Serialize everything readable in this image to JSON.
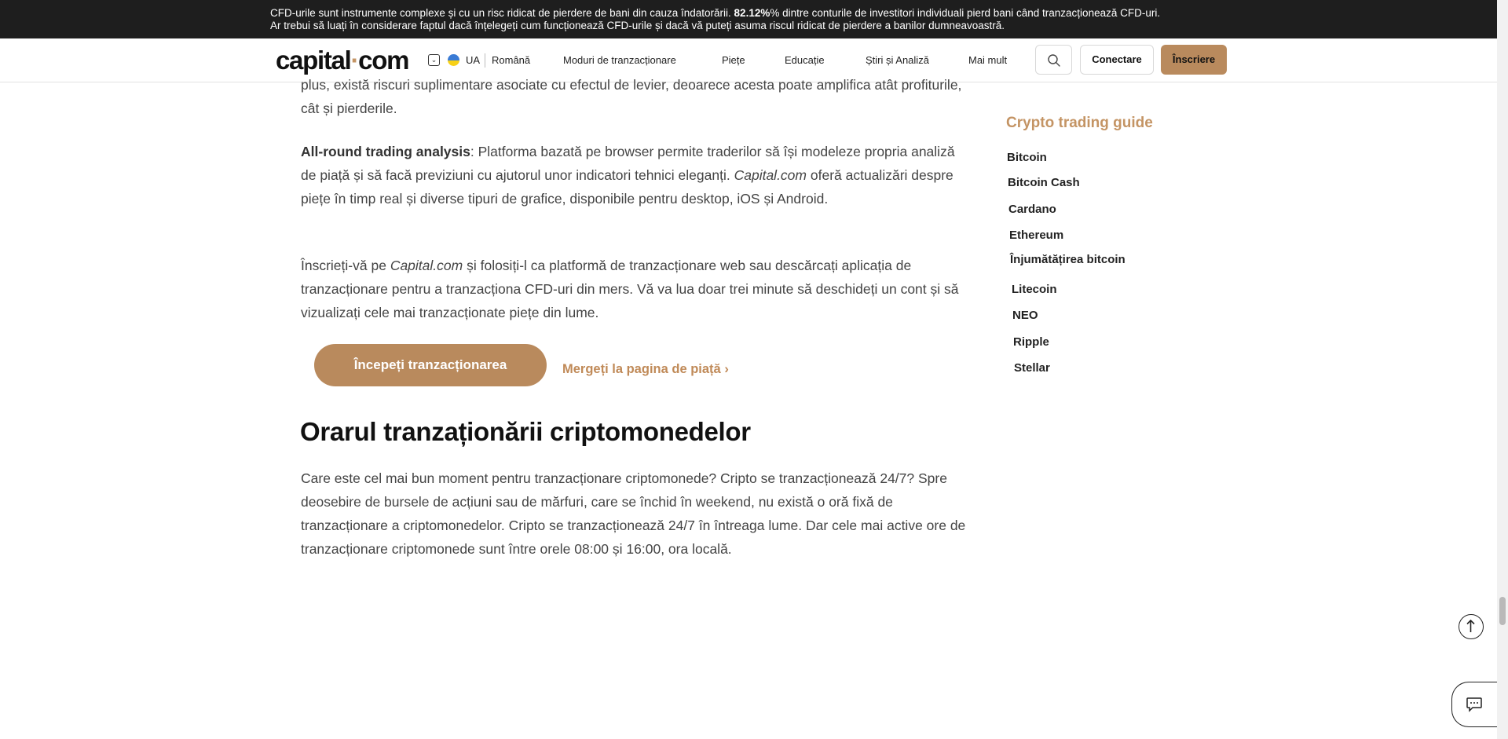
{
  "risk_warning": {
    "line1_prefix": "CFD-urile sunt instrumente complexe și cu un risc ridicat de pierdere de bani din cauza îndatorării.",
    "percentage": "82.12%",
    "line1_suffix": "% dintre conturile de investitori individuali pierd bani când tranzacționează CFD-uri.",
    "line2": "Ar trebui să luați în considerare faptul dacă înțelegeți cum funcționează CFD-urile și dacă vă puteți asuma riscul ridicat de pierdere a banilor dumneavoastră."
  },
  "header": {
    "logo_part1": "capital",
    "logo_dot": "·",
    "logo_part2": "com",
    "region": "UA",
    "language": "Română",
    "nav": [
      "Moduri de tranzacționare",
      "Piețe",
      "Educație",
      "Știri și Analiză",
      "Mai mult"
    ],
    "login": "Conectare",
    "signup": "Înscriere"
  },
  "article": {
    "p1": "plus, există riscuri suplimentare asociate cu efectul de levier, deoarece acesta poate amplifica atât profiturile, cât și pierderile.",
    "p2_bold": "All-round trading analysis",
    "p2_a": ": Platforma bazată pe browser permite traderilor să își modeleze propria analiză de piață și să facă previziuni cu ajutorul unor indicatori tehnici eleganți.",
    "p2_em": "Capital.com",
    "p2_b": "oferă actualizări despre piețe în timp real și diverse tipuri de grafice, disponibile pentru desktop, iOS și Android.",
    "p3_a": "Înscrieți-vă pe",
    "p3_em": "Capital.com",
    "p3_b": "și folosiți-l ca platformă de tranzacționare web sau descărcați aplicația de tranzacționare pentru a tranzacționa CFD-uri din mers. Vă va lua doar trei minute să deschideți un cont și să vizualizați cele mai tranzacționate piețe din lume.",
    "cta_button": "Începeți tranzacționarea",
    "market_link": "Mergeți la pagina de piață",
    "market_link_arrow": "›",
    "section_title": "Orarul tranzaționării criptomonedelor",
    "p4": "Care este cel mai bun moment pentru tranzacționare criptomonede? Cripto se tranzacționează 24/7? Spre deosebire de bursele de acțiuni sau de mărfuri, care se închid în weekend, nu există o oră fixă de tranzacționare a criptomonedelor. Cripto se tranzacționează 24/7 în întreaga lume. Dar cele mai active ore de tranzacționare criptomonede sunt între orele 08:00 și 16:00, ora locală."
  },
  "sidebar": {
    "title": "Crypto trading guide",
    "items": [
      "Bitcoin",
      "Bitcoin Cash",
      "Cardano",
      "Ethereum",
      "Înjumătățirea bitcoin",
      "Litecoin",
      "NEO",
      "Ripple",
      "Stellar"
    ]
  },
  "icons": {
    "lang_dropdown": "chevron-down-icon",
    "flag": "ukraine-flag-icon",
    "search": "search-icon",
    "scroll_top": "arrow-up-icon",
    "chat": "chat-icon"
  },
  "colors": {
    "accent": "#b98a5d",
    "accent_text": "#c49464",
    "risk_bar_bg": "#1e1e1e"
  }
}
